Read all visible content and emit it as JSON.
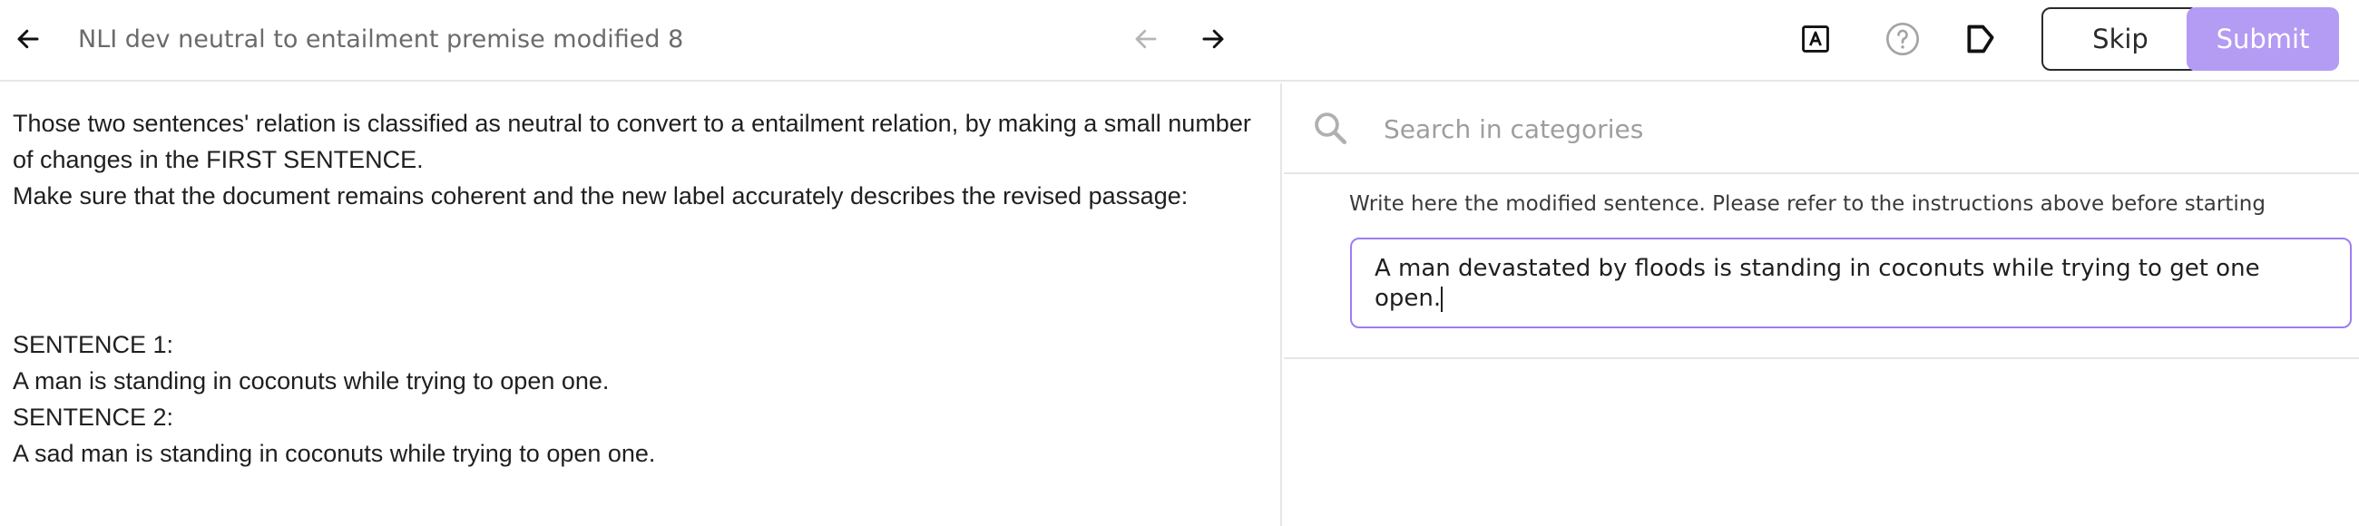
{
  "header": {
    "task_title": "NLI dev neutral to entailment premise modified 8",
    "buttons": {
      "skip": "Skip",
      "submit": "Submit"
    },
    "icons": {
      "back": "arrow-left-icon",
      "prev": "arrow-left-icon",
      "next": "arrow-right-icon",
      "font": "font-size-icon",
      "help": "help-circle-icon",
      "tag": "label-tag-icon"
    },
    "colors": {
      "submit_bg": "#b49bf3",
      "prev_disabled": "#b5b5b5"
    }
  },
  "left_pane": {
    "instruction_line1": "Those two sentences' relation is classified as neutral to convert to a entailment relation, by making a small number of changes in the FIRST SENTENCE.",
    "instruction_line2": "Make sure that the document remains coherent and the new label accurately describes the revised passage:",
    "sentence1_label": "SENTENCE 1:",
    "sentence1_text": "A man is standing in coconuts while trying to open one.",
    "sentence2_label": "SENTENCE 2:",
    "sentence2_text": "A sad man is standing in coconuts while trying to open one."
  },
  "right_pane": {
    "search": {
      "placeholder": "Search in categories",
      "value": "",
      "icon": "search-icon"
    },
    "field": {
      "label": "Write here the modified sentence. Please refer to the instructions above before starting",
      "value": "A man devastated by floods is standing in coconuts while trying to get one open.",
      "border_color": "#9b7ef0"
    }
  }
}
